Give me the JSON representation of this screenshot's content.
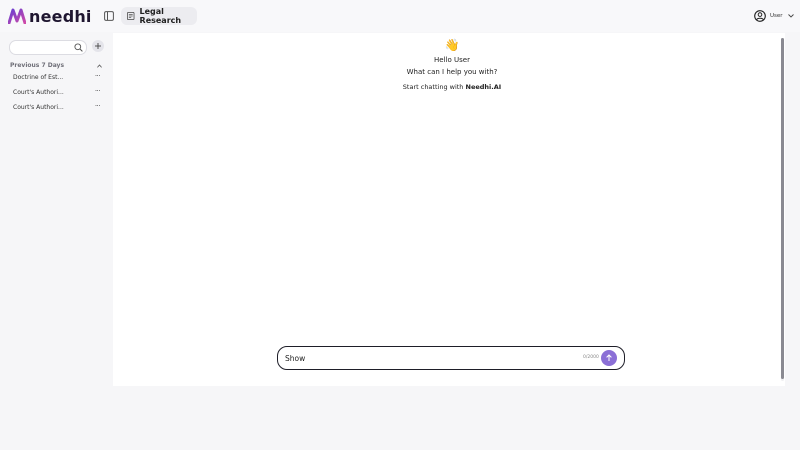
{
  "header": {
    "brand": "needhi",
    "active_tab": "Legal Research",
    "user_label": "User"
  },
  "sidebar": {
    "search_placeholder": "",
    "section_title": "Previous 7 Days",
    "items": [
      {
        "label": "Doctrine of Est..."
      },
      {
        "label": "Court's Authori..."
      },
      {
        "label": "Court's Authori..."
      }
    ]
  },
  "main": {
    "emoji": "👋",
    "greeting": "Hello User",
    "question": "What can I help you with?",
    "start_prefix": "Start chatting with ",
    "start_brand": "Needhi.AI"
  },
  "composer": {
    "value": "Show",
    "char_count": "0/2000"
  },
  "colors": {
    "accent": "#8b6fd6",
    "brand_dark": "#1f1630",
    "brand_gradient_start": "#6a3fd1",
    "brand_gradient_end": "#d04aa8"
  },
  "icons": {
    "logo": "needhi-logo-icon",
    "sidebar_toggle": "sidebar-toggle-icon",
    "tab": "document-icon",
    "user": "user-circle-icon",
    "search": "search-icon",
    "new_chat": "plus-icon",
    "send": "arrow-up-icon"
  }
}
